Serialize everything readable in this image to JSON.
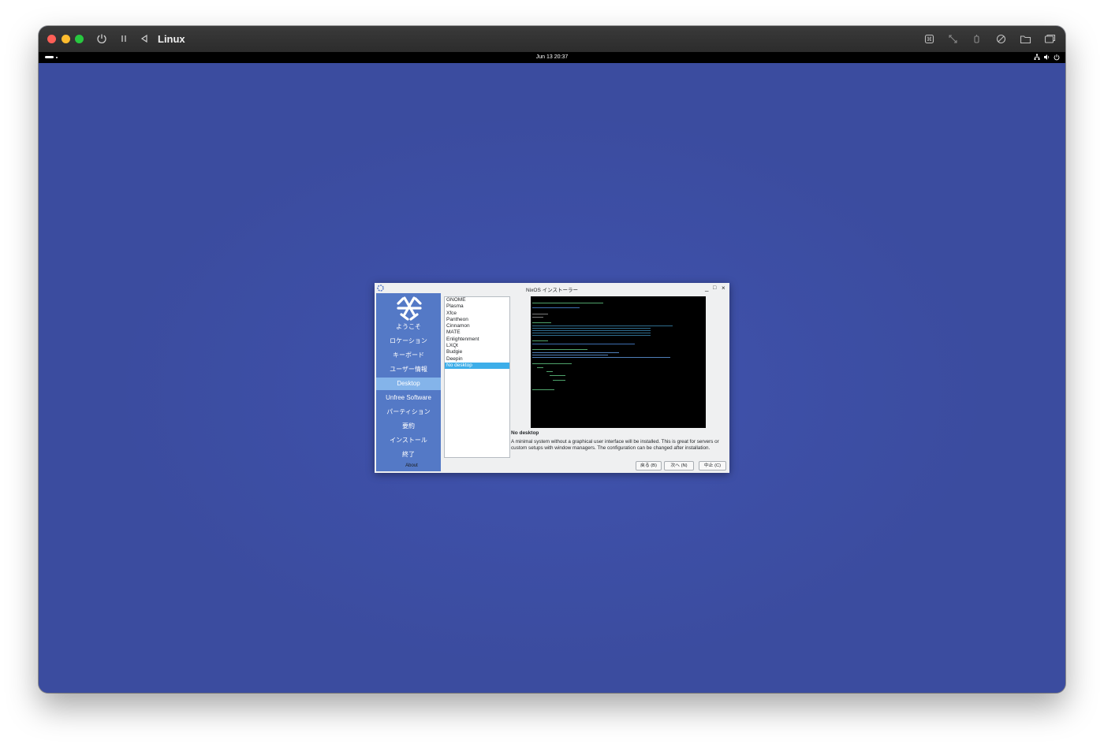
{
  "vm": {
    "title": "Linux",
    "toolbar_icons": [
      "power-icon",
      "pause-icon",
      "back-icon",
      "keyboard-icon",
      "resize-icon",
      "usb-icon",
      "audio-icon",
      "folder-icon",
      "window-icon"
    ]
  },
  "guest": {
    "topbar": {
      "clock": "Jun 13  20:37"
    }
  },
  "installer": {
    "title": "NixOS インストーラー",
    "sidebar": {
      "items": [
        {
          "label": "ようこそ"
        },
        {
          "label": "ロケーション"
        },
        {
          "label": "キーボード"
        },
        {
          "label": "ユーザー情報"
        },
        {
          "label": "Desktop",
          "active": true
        },
        {
          "label": "Unfree Software"
        },
        {
          "label": "パーティション"
        },
        {
          "label": "要約"
        },
        {
          "label": "インストール"
        },
        {
          "label": "終了"
        }
      ],
      "about": "About"
    },
    "desktops": [
      "GNOME",
      "Plasma",
      "Xfce",
      "Pantheon",
      "Cinnamon",
      "MATE",
      "Enlightenment",
      "LXQt",
      "Budgie",
      "Deepin",
      "No desktop"
    ],
    "selected_desktop": "No desktop",
    "preview": {
      "title": "No desktop",
      "description": "A minimal system without a graphical user interface will be installed. This is great for servers or custom setups with window managers. The configuration can be changed after installation."
    },
    "buttons": {
      "back": "戻る (B)",
      "next": "次へ (N)",
      "cancel": "中止 (C)"
    }
  },
  "colors": {
    "desktop_bg": "#3b4c9f",
    "sidebar_bg": "#5479c6",
    "sidebar_active": "#84b4ea",
    "selection": "#3daee9"
  }
}
